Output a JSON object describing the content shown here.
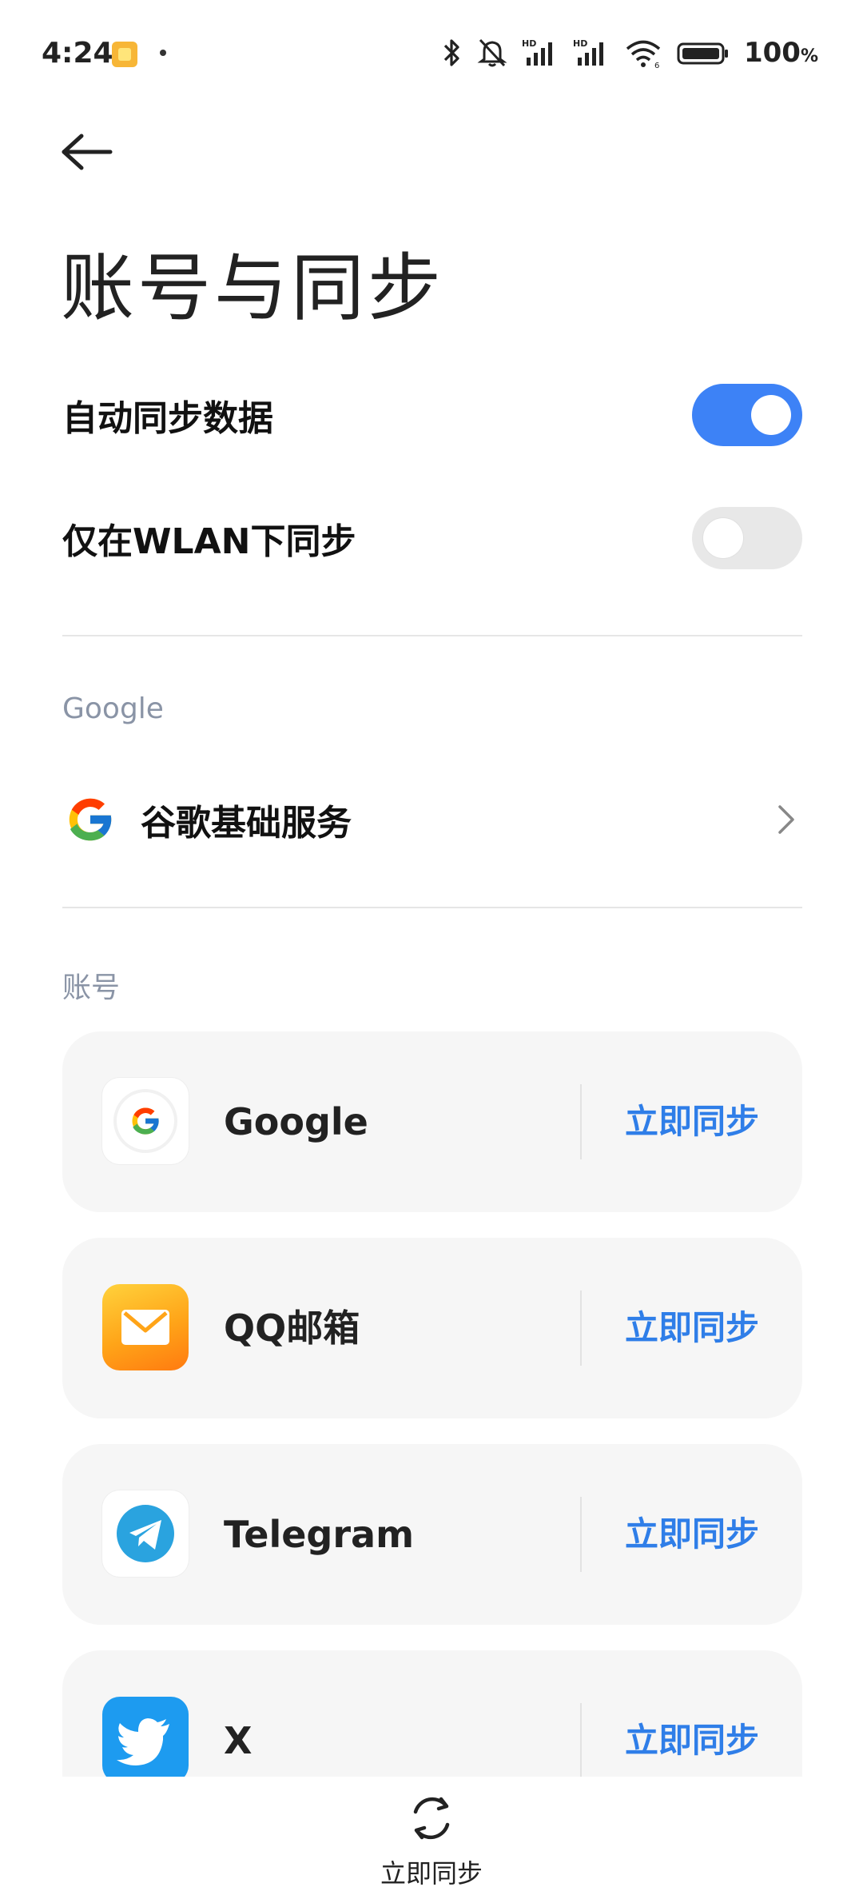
{
  "status_bar": {
    "time": "4:24",
    "battery": "100",
    "battery_unit": "%"
  },
  "page": {
    "title": "账号与同步"
  },
  "settings": {
    "auto_sync": {
      "label": "自动同步数据",
      "enabled": true
    },
    "wlan_only": {
      "label": "仅在WLAN下同步",
      "enabled": false
    }
  },
  "google_section": {
    "header": "Google",
    "service_label": "谷歌基础服务"
  },
  "accounts_section": {
    "header": "账号",
    "items": [
      {
        "name": "Google",
        "sync_label": "立即同步",
        "icon": "google-icon"
      },
      {
        "name": "QQ邮箱",
        "sync_label": "立即同步",
        "icon": "qq-mail-icon"
      },
      {
        "name": "Telegram",
        "sync_label": "立即同步",
        "icon": "telegram-icon"
      },
      {
        "name": "X",
        "sync_label": "立即同步",
        "icon": "twitter-icon"
      }
    ]
  },
  "bottom_bar": {
    "sync_label": "立即同步"
  },
  "colors": {
    "accent": "#3d82f6",
    "link": "#2f7ee8",
    "section_header": "#8a94a6",
    "card_bg": "#f6f6f6"
  }
}
